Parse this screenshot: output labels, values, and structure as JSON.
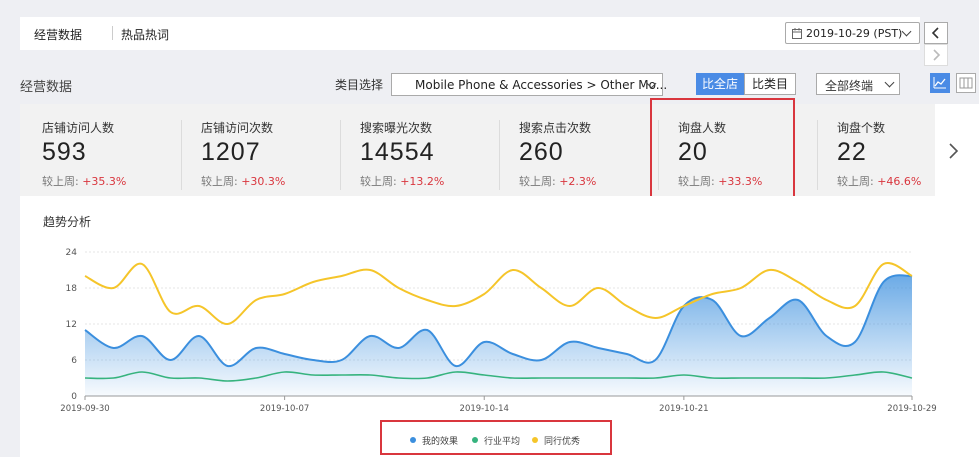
{
  "header": {
    "tab_active": "经营数据",
    "tab_other": "热品热词",
    "date": "2019-10-29 (PST)",
    "prev_icon": "chevron-left-icon",
    "next_icon": "chevron-right-icon"
  },
  "toolbar": {
    "section_title": "经营数据",
    "category_label": "类目选择",
    "category_value": "Mobile Phone & Accessories > Other Mo...",
    "compare_store": "比全店",
    "compare_category": "比类目",
    "terminal_value": "全部终端"
  },
  "metrics": [
    {
      "label": "店铺访问人数",
      "value": "593",
      "compare_label": "较上周: ",
      "change": "+35.3%"
    },
    {
      "label": "店铺访问次数",
      "value": "1207",
      "compare_label": "较上周: ",
      "change": "+30.3%"
    },
    {
      "label": "搜索曝光次数",
      "value": "14554",
      "compare_label": "较上周: ",
      "change": "+13.2%"
    },
    {
      "label": "搜索点击次数",
      "value": "260",
      "compare_label": "较上周: ",
      "change": "+2.3%"
    },
    {
      "label": "询盘人数",
      "value": "20",
      "compare_label": "较上周: ",
      "change": "+33.3%"
    },
    {
      "label": "询盘个数",
      "value": "22",
      "compare_label": "较上周: ",
      "change": "+46.6%"
    }
  ],
  "chart": {
    "title": "趋势分析"
  },
  "chart_data": {
    "type": "line",
    "title": "趋势分析",
    "ylim": [
      0,
      24
    ],
    "yticks": [
      "0",
      "6",
      "12",
      "18",
      "24"
    ],
    "xticks": [
      "2019-09-30",
      "2019-10-07",
      "2019-10-14",
      "2019-10-21",
      "2019-10-29"
    ],
    "x": [
      "2019-09-30",
      "2019-10-01",
      "2019-10-02",
      "2019-10-03",
      "2019-10-04",
      "2019-10-05",
      "2019-10-06",
      "2019-10-07",
      "2019-10-08",
      "2019-10-09",
      "2019-10-10",
      "2019-10-11",
      "2019-10-12",
      "2019-10-13",
      "2019-10-14",
      "2019-10-15",
      "2019-10-16",
      "2019-10-17",
      "2019-10-18",
      "2019-10-19",
      "2019-10-20",
      "2019-10-21",
      "2019-10-22",
      "2019-10-23",
      "2019-10-24",
      "2019-10-25",
      "2019-10-26",
      "2019-10-27",
      "2019-10-28",
      "2019-10-29"
    ],
    "series": [
      {
        "name": "我的效果",
        "color": "#3b8fde",
        "values": [
          11,
          8,
          10,
          6,
          10,
          5,
          8,
          7,
          6,
          6,
          10,
          8,
          11,
          5,
          9,
          7,
          6,
          9,
          8,
          7,
          6,
          15,
          16,
          10,
          13,
          16,
          10,
          9,
          19,
          20
        ]
      },
      {
        "name": "行业平均",
        "color": "#36b37e",
        "values": [
          3,
          3,
          4,
          3,
          3,
          2.5,
          3,
          4,
          3.5,
          3.5,
          3.5,
          3,
          3,
          4,
          3.5,
          3,
          3,
          3,
          3,
          3,
          3,
          3.5,
          3,
          3,
          3,
          3,
          3,
          3.5,
          4,
          3
        ]
      },
      {
        "name": "同行优秀",
        "color": "#f5c52a",
        "values": [
          20,
          18,
          22,
          14,
          15,
          12,
          16,
          17,
          19,
          20,
          21,
          18,
          16,
          15,
          17,
          21,
          18,
          15,
          18,
          15,
          13,
          15,
          17,
          18,
          21,
          19,
          16,
          15,
          22,
          20
        ]
      }
    ],
    "legend": [
      "我的效果",
      "行业平均",
      "同行优秀"
    ],
    "legend_position": "bottom-center",
    "grid": true
  }
}
